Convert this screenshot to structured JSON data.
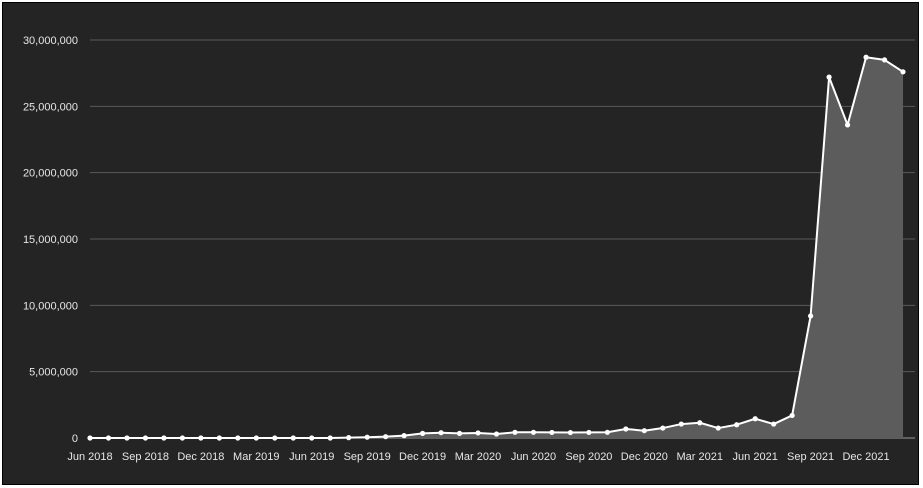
{
  "chart_data": {
    "type": "area",
    "title": "",
    "xlabel": "",
    "ylabel": "",
    "background": "#242424",
    "line_color": "#ffffff",
    "area_color": "#5c5c5c",
    "grid": true,
    "ylim": [
      0,
      30000000
    ],
    "y_ticks": [
      0,
      5000000,
      10000000,
      15000000,
      20000000,
      25000000,
      30000000
    ],
    "y_tick_labels": [
      "0",
      "5,000,000",
      "10,000,000",
      "15,000,000",
      "20,000,000",
      "25,000,000",
      "30,000,000"
    ],
    "x_tick_labels": [
      "Jun 2018",
      "Sep 2018",
      "Dec 2018",
      "Mar 2019",
      "Jun 2019",
      "Sep 2019",
      "Dec 2019",
      "Mar 2020",
      "Jun 2020",
      "Sep 2020",
      "Dec 2020",
      "Mar 2021",
      "Jun 2021",
      "Sep 2021",
      "Dec 2021"
    ],
    "x": [
      "2018-06",
      "2018-07",
      "2018-08",
      "2018-09",
      "2018-10",
      "2018-11",
      "2018-12",
      "2019-01",
      "2019-02",
      "2019-03",
      "2019-04",
      "2019-05",
      "2019-06",
      "2019-07",
      "2019-08",
      "2019-09",
      "2019-10",
      "2019-11",
      "2019-12",
      "2020-01",
      "2020-02",
      "2020-03",
      "2020-04",
      "2020-05",
      "2020-06",
      "2020-07",
      "2020-08",
      "2020-09",
      "2020-10",
      "2020-11",
      "2020-12",
      "2021-01",
      "2021-02",
      "2021-03",
      "2021-04",
      "2021-05",
      "2021-06",
      "2021-07",
      "2021-08",
      "2021-09",
      "2021-10",
      "2021-11",
      "2021-12",
      "2022-01",
      "2022-02"
    ],
    "values": [
      0,
      0,
      0,
      0,
      0,
      0,
      0,
      0,
      0,
      0,
      0,
      0,
      0,
      0,
      30000,
      60000,
      100000,
      180000,
      350000,
      400000,
      350000,
      380000,
      300000,
      430000,
      430000,
      420000,
      410000,
      420000,
      430000,
      680000,
      550000,
      750000,
      1050000,
      1150000,
      750000,
      1000000,
      1450000,
      1050000,
      1700000,
      9200000,
      27200000,
      23600000,
      28700000,
      28500000,
      27600000
    ]
  }
}
